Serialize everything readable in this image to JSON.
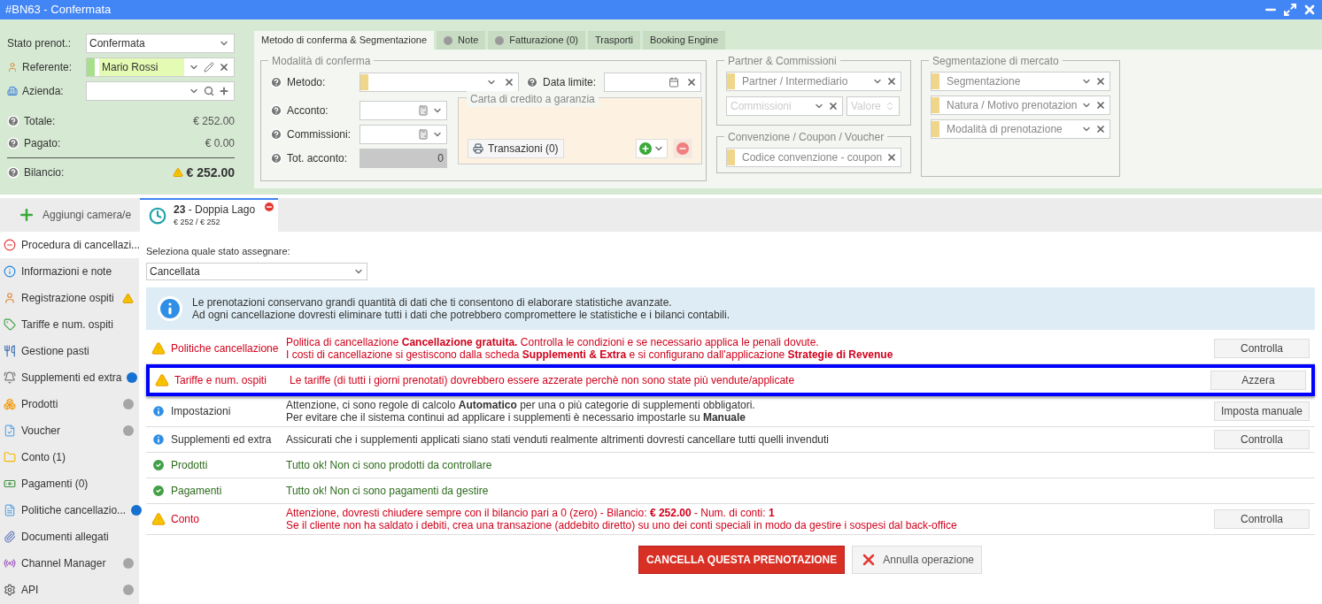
{
  "window": {
    "title": "#BN63 - Confermata"
  },
  "booking": {
    "fields": [
      {
        "label": "Stato prenot.:",
        "kind": "select",
        "value": "Confermata"
      },
      {
        "label": "Referente:",
        "kind": "person",
        "value": "Mario Rossi"
      },
      {
        "label": "Azienda:",
        "kind": "company"
      }
    ],
    "totals": [
      {
        "label": "Totale:",
        "value": "€ 252.00",
        "warning": false
      },
      {
        "label": "Pagato:",
        "value": "€ 0.00",
        "warning": false
      },
      {
        "label": "Bilancio:",
        "value": "€ 252.00",
        "warning": true
      }
    ]
  },
  "tabs": [
    {
      "label": "Metodo di conferma & Segmentazione",
      "selected": true,
      "dot": false
    },
    {
      "label": "Note",
      "selected": false,
      "dot": true
    },
    {
      "label": "Fatturazione (0)",
      "selected": false,
      "dot": true
    },
    {
      "label": "Trasporti",
      "selected": false,
      "dot": false
    },
    {
      "label": "Booking Engine",
      "selected": false,
      "dot": false
    }
  ],
  "modalita": {
    "legend": "Modalità di conferma",
    "fields": [
      {
        "label": "Metodo:",
        "kind": "select"
      },
      {
        "label": "Data limite:",
        "kind": "date"
      },
      {
        "label": "Acconto:",
        "kind": "calc"
      },
      {
        "label": "Commissioni:",
        "kind": "calc"
      },
      {
        "label": "Tot. acconto:",
        "kind": "readonly",
        "value": "0"
      }
    ],
    "card": {
      "legend": "Carta di credito a garanzia",
      "button": "Transazioni (0)"
    }
  },
  "partner": {
    "legend": "Partner & Commissioni",
    "fields": [
      {
        "placeholder": "Partner / Intermediario",
        "kind": "select",
        "disabled": false
      },
      {
        "placeholder": "Commissioni",
        "kind": "select",
        "disabled": true
      },
      {
        "placeholder": "Valore",
        "kind": "spinner",
        "disabled": true
      }
    ]
  },
  "convenzione": {
    "legend": "Convenzione / Coupon / Voucher",
    "placeholder": "Codice convenzione - coupon"
  },
  "segmentazione": {
    "legend": "Segmentazione di mercato",
    "fields": [
      {
        "placeholder": "Segmentazione"
      },
      {
        "placeholder": "Natura / Motivo prenotazion"
      },
      {
        "placeholder": "Modalità di prenotazione"
      }
    ]
  },
  "add_room": "Aggiungi camera/e",
  "room_tab": {
    "number": "23",
    "name": "- Doppia Lago",
    "price": "€ 252 / € 252",
    "selected": true
  },
  "sidebar": {
    "items": [
      {
        "label": "Procedura di cancellazi...",
        "selected": true,
        "alert": false
      },
      {
        "label": "Informazioni e note",
        "selected": false,
        "alert": false
      },
      {
        "label": "Registrazione ospiti",
        "selected": false,
        "alert": true
      },
      {
        "label": "Tariffe e num. ospiti",
        "selected": false,
        "alert": false
      },
      {
        "label": "Gestione pasti",
        "selected": false,
        "alert": false
      },
      {
        "label": "Supplementi ed extra",
        "selected": false,
        "alert": false,
        "color": "#1670d0"
      },
      {
        "label": "Prodotti",
        "selected": false,
        "alert": false,
        "color": "#a6a6a6"
      },
      {
        "label": "Voucher",
        "selected": false,
        "alert": false,
        "color": "#a6a6a6"
      },
      {
        "label": "Conto (1)",
        "selected": false,
        "alert": false
      },
      {
        "label": "Pagamenti (0)",
        "selected": false,
        "alert": false
      },
      {
        "label": "Politiche cancellazio...",
        "selected": false,
        "alert": false,
        "color": "#1670d0"
      },
      {
        "label": "Documenti allegati",
        "selected": false,
        "alert": false
      },
      {
        "label": "Channel Manager",
        "selected": false,
        "alert": false,
        "color": "#a6a6a6"
      },
      {
        "label": "API",
        "selected": false,
        "alert": false,
        "color": "#a6a6a6"
      }
    ]
  },
  "content": {
    "state_label": "Seleziona quale stato assegnare:",
    "state_value": "Cancellata",
    "info": [
      "Le prenotazioni conservano grandi quantità di dati che ti consentono di elaborare statistiche avanzate.",
      "Ad ogni cancellazione dovresti eliminare tutti i dati che potrebbero compromettere le statistiche e i bilanci contabili."
    ],
    "checks": [
      {
        "kind": "warning",
        "title": "Politiche cancellazione",
        "lines": [
          "Politica di cancellazione **Cancellazione gratuita.** Controlla le condizioni e se necessario applica le penali dovute.",
          "I costi di cancellazione si gestiscono dalla scheda **Supplementi & Extra** e si configurano dall'applicazione **Strategie di Revenue**"
        ],
        "button": "Controlla",
        "highlighted": false
      },
      {
        "kind": "warning",
        "title": "Tariffe e num. ospiti",
        "lines": [
          "Le tariffe (di tutti i giorni prenotati) dovrebbero essere azzerate perchè non sono state più vendute/applicate"
        ],
        "button": "Azzera",
        "highlighted": true
      },
      {
        "kind": "info",
        "title": "Impostazioni",
        "lines": [
          "Attenzione, ci sono regole di calcolo **Automatico** per una o più categorie di supplementi obbligatori.",
          "Per evitare che il sistema continui ad applicare i supplementi è necessario impostarle su **Manuale**"
        ],
        "button": "Imposta manuale",
        "highlighted": false
      },
      {
        "kind": "info",
        "title": "Supplementi ed extra",
        "lines": [
          "Assicurati che i supplementi applicati siano stati venduti realmente altrimenti dovresti cancellare tutti quelli invenduti"
        ],
        "button": "Controlla",
        "highlighted": false
      },
      {
        "kind": "ok",
        "title": "Prodotti",
        "lines": [
          "Tutto ok! Non ci sono prodotti da controllare"
        ],
        "highlighted": false
      },
      {
        "kind": "ok",
        "title": "Pagamenti",
        "lines": [
          "Tutto ok! Non ci sono pagamenti da gestire"
        ],
        "highlighted": false
      },
      {
        "kind": "warning",
        "title": "Conto",
        "lines": [
          "Attenzione, dovresti chiudere sempre con il bilancio pari a 0 (zero) - Bilancio: **€ 252.00** - Num. di conti: **1**",
          "Se il cliente non ha saldato i debiti, crea una transazione (addebito diretto) su uno dei conti speciali in modo da gestire i sospesi dal back-office"
        ],
        "button": "Controlla",
        "highlighted": false
      }
    ],
    "confirm_button": "CANCELLA QUESTA PRENOTAZIONE",
    "cancel_button": "Annulla operazione"
  }
}
